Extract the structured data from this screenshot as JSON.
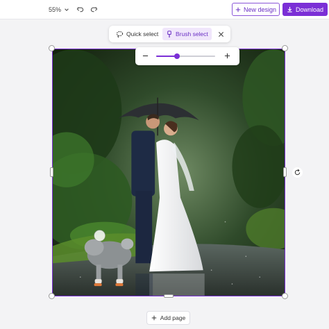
{
  "header": {
    "zoom": "55%",
    "new_design": "New design",
    "download": "Download"
  },
  "tools": {
    "quick_select": "Quick select",
    "brush_select": "Brush select"
  },
  "brush_size": {
    "value_fraction": 0.35
  },
  "footer": {
    "add_page": "Add page"
  },
  "colors": {
    "accent": "#7b2fd6",
    "brush_tab_bg": "#f0e6fb",
    "canvas_bg": "#f3f3f5"
  },
  "icons": [
    "chevron-down-icon",
    "undo-icon",
    "redo-icon",
    "plus-icon",
    "download-icon",
    "lasso-icon",
    "brush-icon",
    "close-icon",
    "minus-icon",
    "rotate-icon"
  ]
}
